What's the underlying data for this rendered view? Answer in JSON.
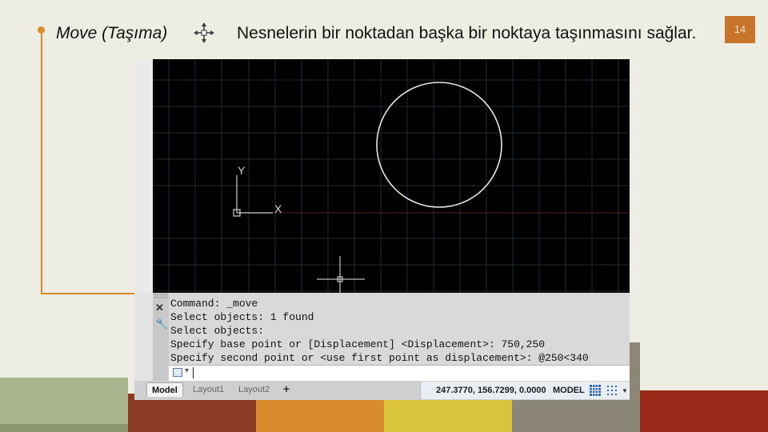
{
  "slide": {
    "title": "Move (Taşıma)",
    "description": "Nesnelerin bir noktadan başka bir noktaya taşınmasını sağlar.",
    "page_number": "14"
  },
  "colors": {
    "accent_orange": "#d98b2b",
    "page_badge": "#c8742b",
    "strip": [
      "#a9b48c",
      "#8b3a25",
      "#d98b2b",
      "#d9c43c",
      "#8b8676",
      "#9c2a1a"
    ]
  },
  "cad": {
    "ucs": {
      "y_label": "Y",
      "x_label": "X"
    },
    "command_lines": [
      "Command: _move",
      "Select objects: 1 found",
      "Select objects:",
      "Specify base point or [Displacement] <Displacement>: 750,250",
      "Specify second point or <use first point as displacement>: @250<340"
    ],
    "tabs": {
      "model": "Model",
      "layout1": "Layout1",
      "layout2": "Layout2"
    },
    "status": {
      "coordinates": "247.3770, 156.7299, 0.0000",
      "mode": "MODEL"
    },
    "icons": [
      "move-icon",
      "close-icon",
      "wrench-icon",
      "command-prompt-icon",
      "plus-icon",
      "grid-icon",
      "snap-icon",
      "chevron-down-icon"
    ]
  }
}
